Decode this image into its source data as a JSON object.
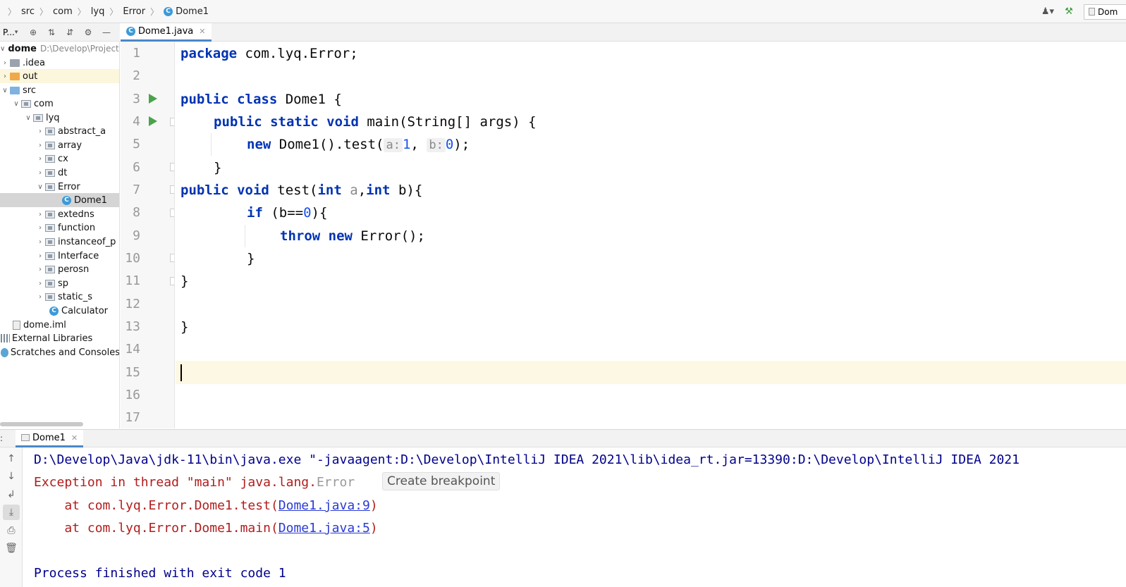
{
  "breadcrumb": [
    "src",
    "com",
    "lyq",
    "Error",
    "Dome1"
  ],
  "toolbar": {
    "run_config": "Dom"
  },
  "project_panel": {
    "title": "P...",
    "root_name": "dome",
    "root_path": "D:\\Develop\\Projects",
    "items": [
      ".idea",
      "out",
      "src",
      "com",
      "lyq",
      "abstract_a",
      "array",
      "cx",
      "dt",
      "Error",
      "Dome1",
      "extedns",
      "function",
      "instanceof_p",
      "Interface",
      "perosn",
      "sp",
      "static_s",
      "Calculator",
      "dome.iml",
      "External Libraries",
      "Scratches and Consoles"
    ]
  },
  "editor": {
    "tab_label": "Dome1.java",
    "line_numbers": [
      "1",
      "2",
      "3",
      "4",
      "5",
      "6",
      "7",
      "8",
      "9",
      "10",
      "11",
      "12",
      "13",
      "14",
      "15",
      "16",
      "17"
    ],
    "hint_a": "a:",
    "hint_b": "b:",
    "code": {
      "l1_kw": "package",
      "l1_rest": " com.lyq.Error;",
      "l3_kw": "public class",
      "l3_rest": " Dome1 {",
      "l4_kw": "public static void",
      "l4_rest": " main(String[] args) {",
      "l5_kw": "new",
      "l5_a": " Dome1().test(",
      "l5_v1": "1",
      "l5_comma": ",",
      "l5_v2": "0",
      "l5_end": ");",
      "l6": "}",
      "l7_kw1": "public void",
      "l7_a": " test(",
      "l7_kw2": "int",
      "l7_p1": "a",
      "l7_c": ",",
      "l7_kw3": "int",
      "l7_end": " b){",
      "l8_kw": "if",
      "l8_a": " (b==",
      "l8_v": "0",
      "l8_end": "){",
      "l9_kw1": "throw",
      "l9_kw2": "new",
      "l9_end": " Error();",
      "l10": "}",
      "l11": "}",
      "l13": "}"
    }
  },
  "run_panel": {
    "label": ":",
    "tab_label": "Dome1",
    "console": {
      "cmd": "D:\\Develop\\Java\\jdk-11\\bin\\java.exe \"-javaagent:D:\\Develop\\IntelliJ IDEA 2021\\lib\\idea_rt.jar=13390:D:\\Develop\\IntelliJ IDEA 2021",
      "exception_prefix": "Exception in thread \"main\" java.lang.",
      "exception_class": "Error",
      "trace1_prefix": "    at com.lyq.Error.Dome1.test(",
      "trace1_link": "Dome1.java:9",
      "trace2_prefix": "    at com.lyq.Error.Dome1.main(",
      "trace2_link": "Dome1.java:5",
      "close_paren": ")",
      "finished": "Process finished with exit code 1"
    },
    "tooltip": "Create breakpoint"
  },
  "colors": {
    "keyword": "#0033b3",
    "number": "#1750eb",
    "error_text": "#b11d1d",
    "console_text": "#00008b",
    "link": "#2a3bd6",
    "current_line": "#fdf8e3",
    "run_gutter": "#4aa34a"
  }
}
